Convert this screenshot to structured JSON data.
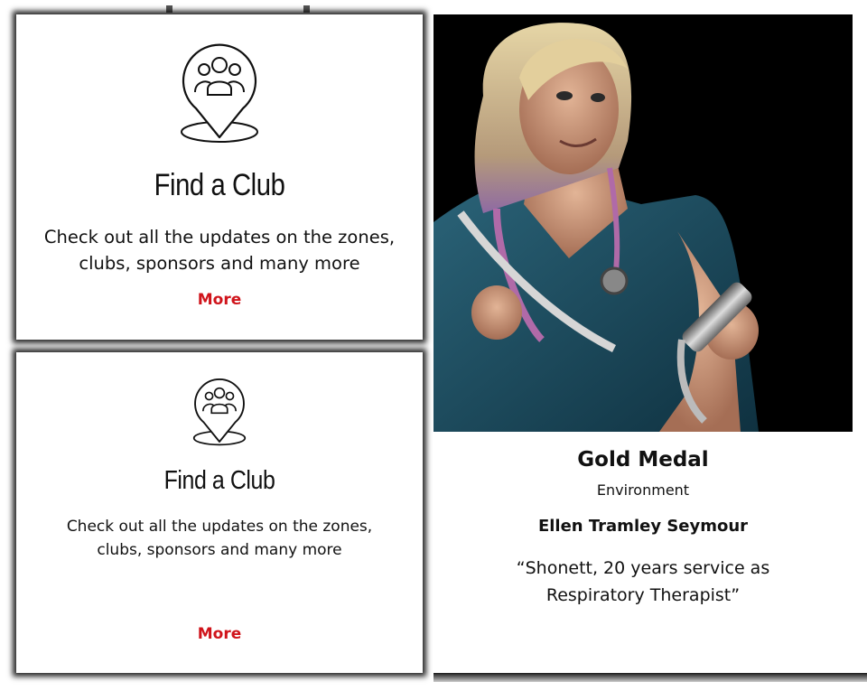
{
  "cards": [
    {
      "icon": "club-location-pin-icon",
      "title": "Find a Club",
      "description": "Check out all the updates on the zones, clubs, sponsors and many more",
      "link": "More"
    },
    {
      "icon": "club-location-pin-icon",
      "title": "Find a Club",
      "description": "Check out all the updates on the zones, clubs, sponsors and many more",
      "link": "More"
    }
  ],
  "profile": {
    "photo": "nurse-with-stethoscope-photo",
    "award": "Gold Medal",
    "category": "Environment",
    "name": "Ellen Tramley Seymour",
    "quote": "“Shonett, 20 years service as Respiratory Therapist”"
  },
  "colors": {
    "link": "#d0141b",
    "text": "#111111",
    "photo_bg": "#000000",
    "scrubs": "#1f4e63"
  }
}
